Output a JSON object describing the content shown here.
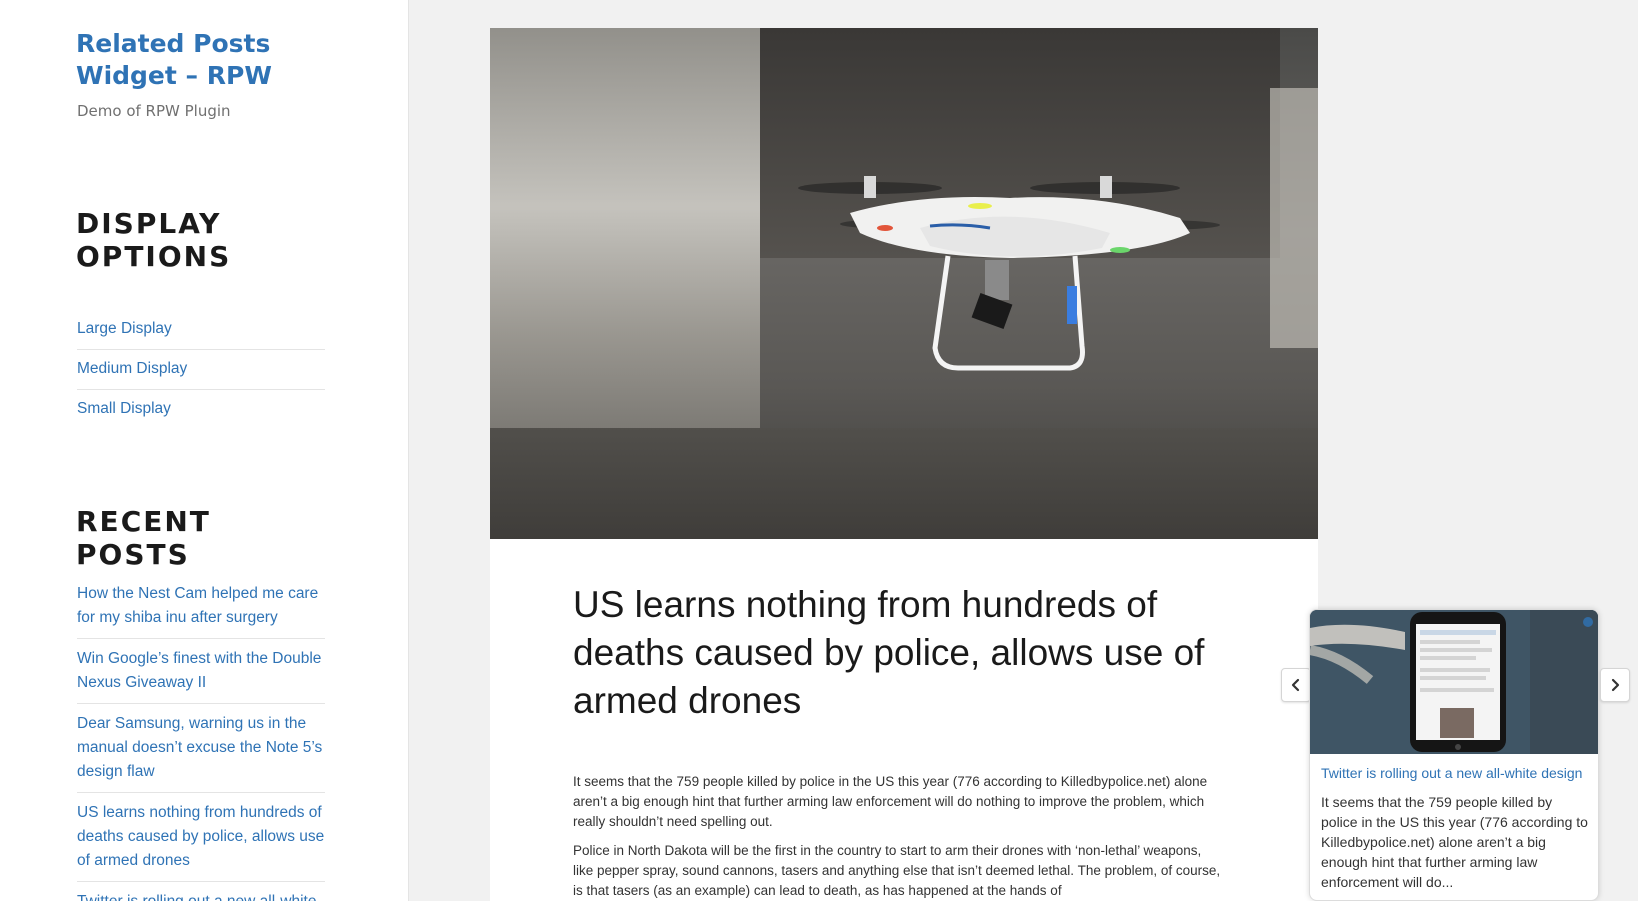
{
  "site": {
    "title": "Related Posts Widget – RPW",
    "description": "Demo of RPW Plugin"
  },
  "sidebar": {
    "display_options": {
      "title": "DISPLAY OPTIONS",
      "items": [
        {
          "label": "Large Display"
        },
        {
          "label": "Medium Display"
        },
        {
          "label": "Small Display"
        }
      ]
    },
    "recent_posts": {
      "title": "RECENT POSTS",
      "items": [
        {
          "label": "How the Nest Cam helped me care for my shiba inu after surgery"
        },
        {
          "label": "Win Google’s finest with the Double Nexus Giveaway II"
        },
        {
          "label": "Dear Samsung, warning us in the manual doesn’t excuse the Note 5’s design flaw"
        },
        {
          "label": "US learns nothing from hundreds of deaths caused by police, allows use of armed drones"
        },
        {
          "label": "Twitter is rolling out a new all-white design"
        }
      ]
    }
  },
  "article": {
    "hero_alt": "drone-photo",
    "title": "US learns nothing from hundreds of deaths caused by police, allows use of armed drones",
    "paragraphs": [
      "It seems that the 759 people killed by police in the US this year (776 according to Killedbypolice.net) alone aren’t a big enough hint that further arming law enforcement will do nothing to improve the problem, which really shouldn’t need spelling out.",
      "Police in North Dakota will be the first in the country to start to arm their drones with ‘non-lethal’ weapons, like pepper spray, sound cannons, tasers and anything else that isn’t deemed lethal. The problem, of course, is that tasers (as an example) can lead to death, as has happened at the hands of"
    ]
  },
  "related": {
    "prev_icon": "chevron-left-icon",
    "next_icon": "chevron-right-icon",
    "card": {
      "title": "Twitter is rolling out a new all-white design",
      "excerpt": "It seems that the 759 people killed by police in the US this year (776 according to Killedbypolice.net) alone aren’t a big enough hint that further arming law enforcement will do..."
    }
  },
  "colors": {
    "link": "#2f73b5",
    "heading": "#1a1a1a",
    "background": "#f1f1f1"
  }
}
